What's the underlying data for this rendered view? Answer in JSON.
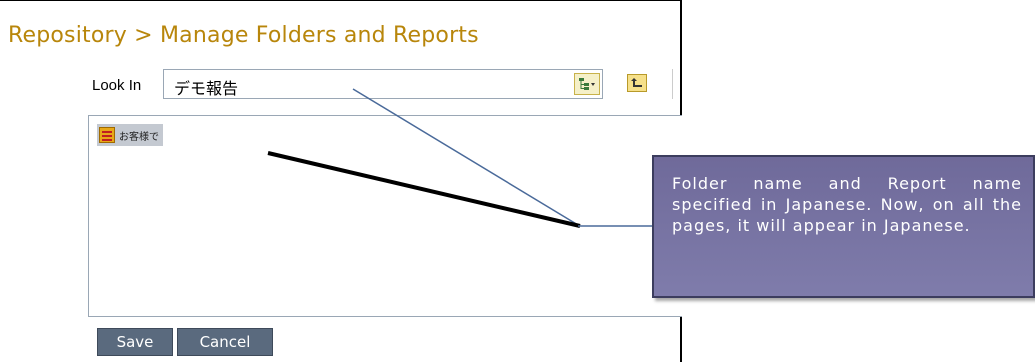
{
  "breadcrumb": "Repository > Manage Folders and Reports",
  "look_in": {
    "label": "Look In",
    "value": "デモ報告"
  },
  "icons": {
    "folder_tree": "folder-tree-icon",
    "up_folder": "up-folder-icon",
    "report": "report-icon"
  },
  "list": {
    "items": [
      {
        "label": "お客様で"
      }
    ]
  },
  "buttons": {
    "save": "Save",
    "cancel": "Cancel"
  },
  "callout": {
    "text": "Folder name and Report name specified in Japanese. Now, on all the pages, it will appear in Japanese."
  },
  "colors": {
    "breadcrumb": "#b8860b",
    "button_bg": "#5a6a7e",
    "callout_bg": "#7572a3",
    "selection": "#c4c9d1"
  }
}
